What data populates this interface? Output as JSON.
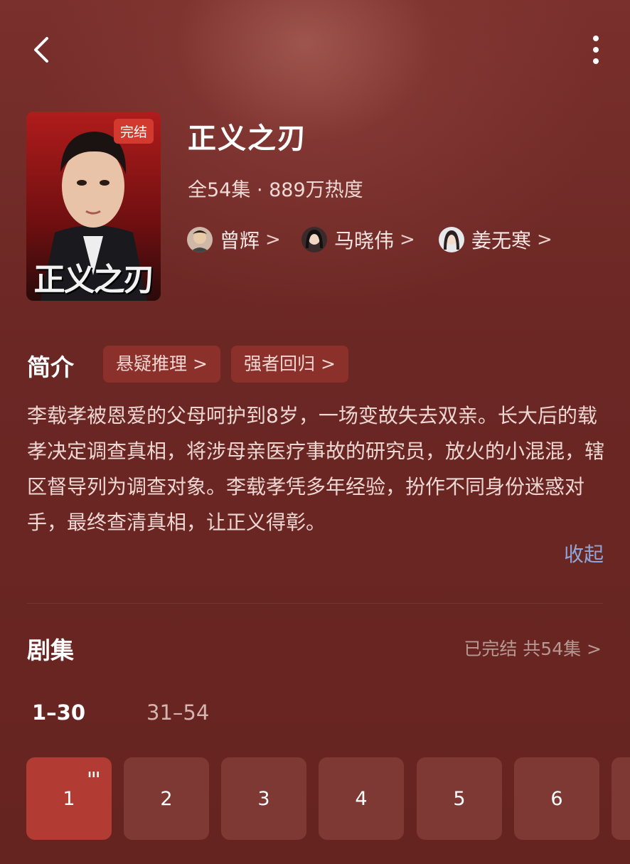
{
  "colors": {
    "background": "#6a2623",
    "accent": "#b23c33",
    "tag_bg": "#8c302b",
    "link": "#8fa7d8"
  },
  "header": {
    "back_icon": "chevron-left-icon",
    "more_icon": "more-vertical-icon"
  },
  "show": {
    "badge": "完结",
    "title": "正义之刃",
    "meta": "全54集 · 889万热度",
    "poster_title": "正义之刃",
    "cast": [
      {
        "name": "曾辉",
        "chevron": ">"
      },
      {
        "name": "马晓伟",
        "chevron": ">"
      },
      {
        "name": "姜无寒",
        "chevron": ">"
      }
    ]
  },
  "intro": {
    "heading": "简介",
    "tags": [
      {
        "label": "悬疑推理 >"
      },
      {
        "label": "强者回归 >"
      }
    ],
    "description": "李载孝被恩爱的父母呵护到8岁，一场变故失去双亲。长大后的载孝决定调查真相，将涉母亲医疗事故的研究员，放火的小混混，辖区督导列为调查对象。李载孝凭多年经验，扮作不同身份迷惑对手，最终查清真相，让正义得彰。",
    "collapse": "收起"
  },
  "episodes": {
    "heading": "剧集",
    "status": "已完结 共54集 >",
    "ranges": [
      {
        "label": "1–30",
        "selected": true
      },
      {
        "label": "31–54",
        "selected": false
      }
    ],
    "items": [
      {
        "label": "1",
        "active": true,
        "bars": "ııı"
      },
      {
        "label": "2"
      },
      {
        "label": "3"
      },
      {
        "label": "4"
      },
      {
        "label": "5"
      },
      {
        "label": "6"
      }
    ]
  }
}
